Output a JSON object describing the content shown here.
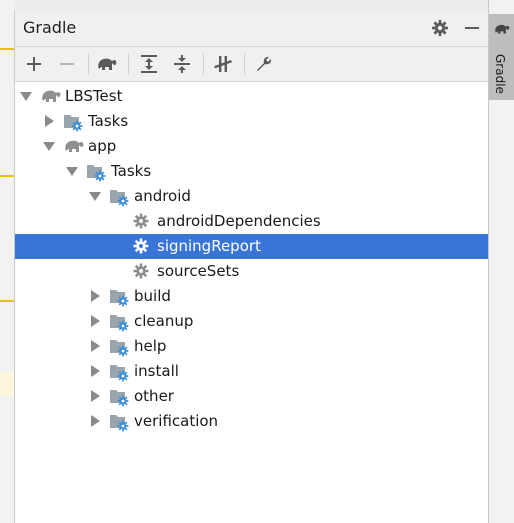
{
  "panel": {
    "title": "Gradle"
  },
  "toolbar": {
    "buttons": [
      {
        "name": "add-icon"
      },
      {
        "name": "remove-icon"
      },
      {
        "name": "gradle-elephant-icon"
      },
      {
        "name": "expand-all-icon"
      },
      {
        "name": "collapse-all-icon"
      },
      {
        "name": "toggle-offline-icon"
      },
      {
        "name": "wrench-icon"
      }
    ]
  },
  "tree": [
    {
      "label": "LBSTest",
      "icon": "elephant",
      "state": "expanded",
      "depth": 0,
      "selected": false
    },
    {
      "label": "Tasks",
      "icon": "folder-gear",
      "state": "collapsed",
      "depth": 1,
      "selected": false
    },
    {
      "label": "app",
      "icon": "elephant",
      "state": "expanded",
      "depth": 1,
      "selected": false
    },
    {
      "label": "Tasks",
      "icon": "folder-gear",
      "state": "expanded",
      "depth": 2,
      "selected": false
    },
    {
      "label": "android",
      "icon": "folder-gear",
      "state": "expanded",
      "depth": 3,
      "selected": false
    },
    {
      "label": "androidDependencies",
      "icon": "gear",
      "state": "leaf",
      "depth": 4,
      "selected": false
    },
    {
      "label": "signingReport",
      "icon": "gear",
      "state": "leaf",
      "depth": 4,
      "selected": true
    },
    {
      "label": "sourceSets",
      "icon": "gear",
      "state": "leaf",
      "depth": 4,
      "selected": false
    },
    {
      "label": "build",
      "icon": "folder-gear",
      "state": "collapsed",
      "depth": 3,
      "selected": false
    },
    {
      "label": "cleanup",
      "icon": "folder-gear",
      "state": "collapsed",
      "depth": 3,
      "selected": false
    },
    {
      "label": "help",
      "icon": "folder-gear",
      "state": "collapsed",
      "depth": 3,
      "selected": false
    },
    {
      "label": "install",
      "icon": "folder-gear",
      "state": "collapsed",
      "depth": 3,
      "selected": false
    },
    {
      "label": "other",
      "icon": "folder-gear",
      "state": "collapsed",
      "depth": 3,
      "selected": false
    },
    {
      "label": "verification",
      "icon": "folder-gear",
      "state": "collapsed",
      "depth": 3,
      "selected": false
    }
  ],
  "side_tab": {
    "label": "Gradle"
  },
  "colors": {
    "selection": "#3875d7",
    "gear_blue": "#3b8fd6",
    "folder": "#9aa4ad"
  }
}
